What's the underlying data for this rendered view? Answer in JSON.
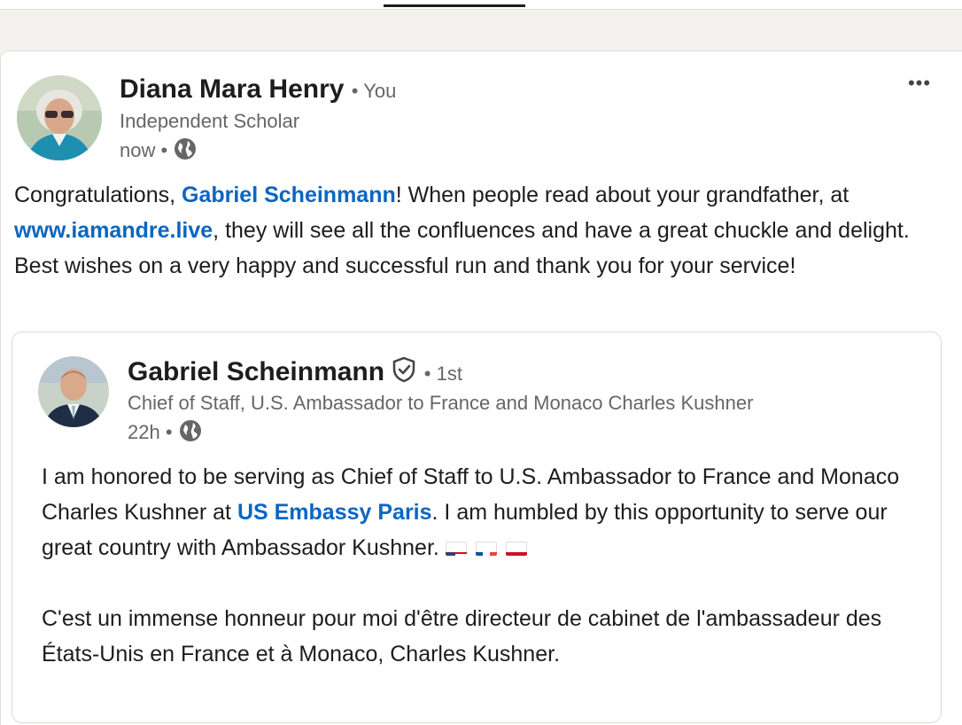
{
  "post": {
    "author_name": "Diana Mara Henry",
    "author_relation": "• You",
    "author_headline": "Independent Scholar",
    "timestamp": "now",
    "dot": "•",
    "more_label": "•••",
    "text_before": "Congratulations, ",
    "mention": "Gabriel Scheinmann",
    "text_mid1": "! When people read about your grandfather, at ",
    "link": "www.iamandre.live",
    "text_after": ", they will see all the confluences and have a great chuckle and delight. Best wishes on a very happy and successful run and thank you for your service!"
  },
  "shared_post": {
    "author_name": "Gabriel Scheinmann",
    "connection": "• 1st",
    "author_headline": "Chief of Staff, U.S. Ambassador to France and Monaco Charles Kushner",
    "timestamp": "22h",
    "dot": "•",
    "paragraph1_before": "I am honored to be serving as Chief of Staff to U.S. Ambassador to France and Monaco Charles Kushner at ",
    "paragraph1_link": "US Embassy Paris",
    "paragraph1_after": ". I am humbled by this opportunity to serve our great country with Ambassador Kushner.",
    "paragraph2": "C'est un immense honneur pour moi d'être directeur de cabinet de l'ambassadeur des États-Unis en France et à Monaco, Charles Kushner."
  },
  "icons": {
    "visibility": "globe-icon",
    "verified": "verified-shield-icon",
    "flags": [
      "us-flag-icon",
      "france-flag-icon",
      "monaco-flag-icon"
    ]
  },
  "colors": {
    "link": "#0a66c2",
    "text": "#1d1d1d",
    "muted": "#666666",
    "background": "#f3f2ef"
  }
}
